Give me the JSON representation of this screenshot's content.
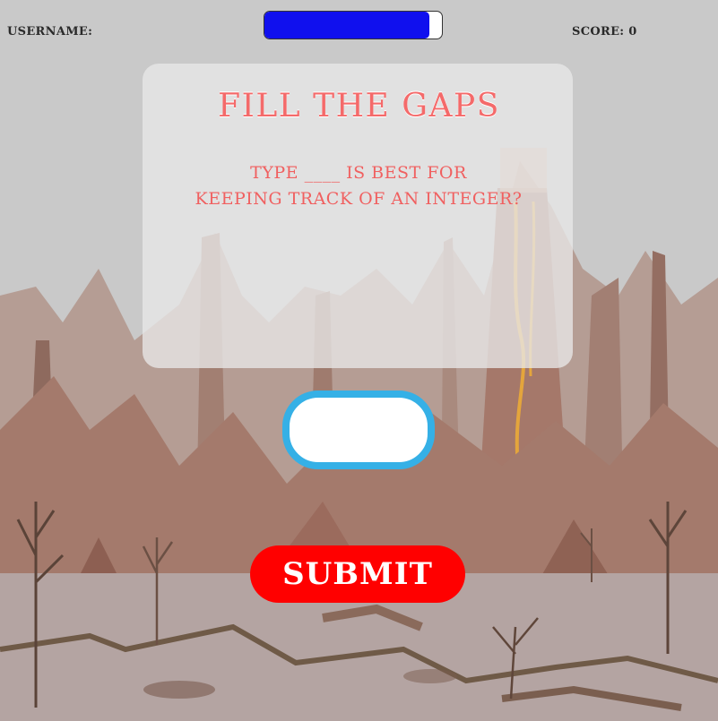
{
  "hud": {
    "username_label": "USERNAME:",
    "score_label": "SCORE: 0"
  },
  "timer": {
    "fill_fraction": 0.93,
    "fill_color": "#1010ee"
  },
  "panel": {
    "title": "FILL THE GAPS",
    "question_line1": "TYPE ____ IS BEST FOR",
    "question_line2": "KEEPING TRACK OF AN INTEGER?"
  },
  "answer_input": {
    "value": "",
    "placeholder": ""
  },
  "submit_button": {
    "label": "SUBMIT"
  },
  "colors": {
    "title": "#f46a6a",
    "question": "#f06060",
    "input_border": "#35b0e6",
    "submit_bg": "#ff0000"
  }
}
